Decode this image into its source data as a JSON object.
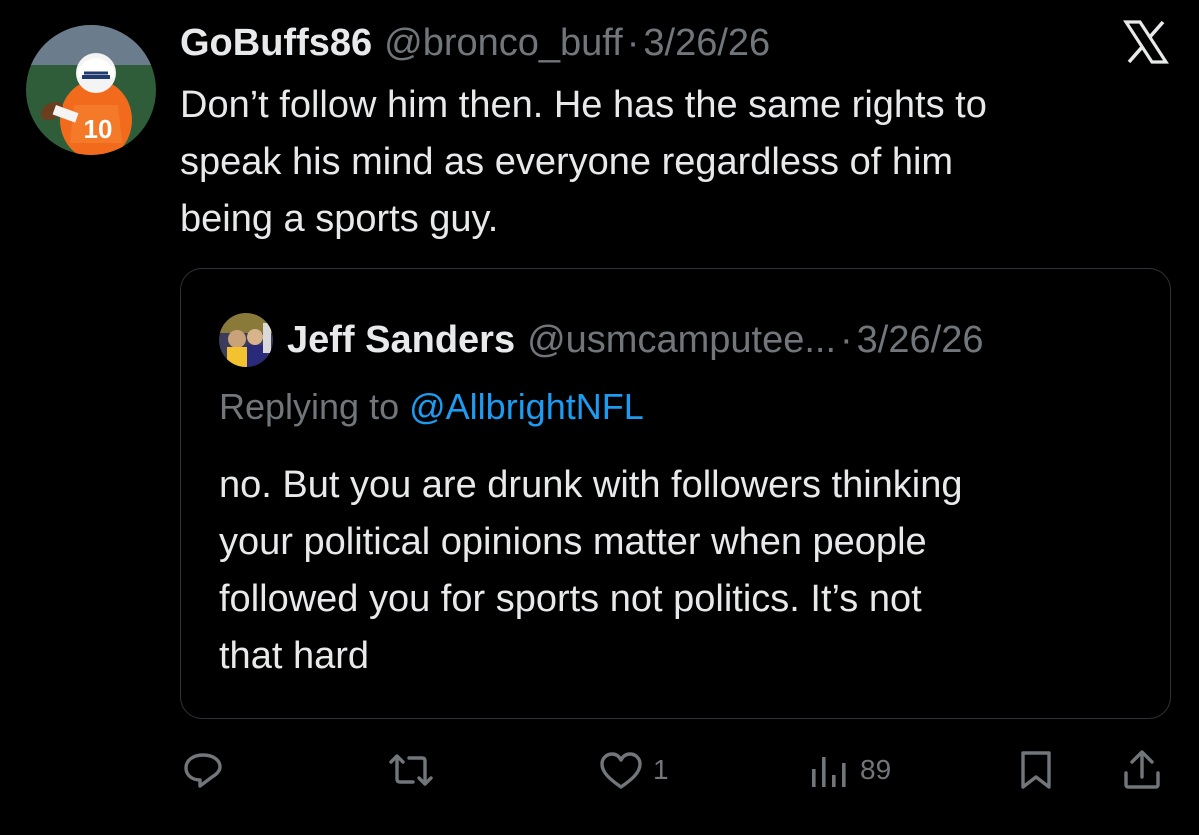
{
  "post": {
    "display_name": "GoBuffs86",
    "handle": "@bronco_buff",
    "separator": "·",
    "date": "3/26/26",
    "avatar_icon": "football-player-avatar",
    "text_lines": [
      "Don’t follow him then. He has the same rights to",
      "speak his mind as everyone regardless of him",
      "being a sports guy."
    ]
  },
  "quoted_post": {
    "display_name": "Jeff Sanders",
    "handle": "@usmcamputee...",
    "separator": "·",
    "date": "3/26/26",
    "avatar_icon": "user-avatar",
    "replying_prefix": "Replying to",
    "replying_to": "@AllbrightNFL",
    "text_lines": [
      "no. But you are drunk with followers thinking",
      "your political opinions matter when people",
      "followed you for sports not politics. It’s not",
      "that hard"
    ]
  },
  "actions": {
    "reply_icon": "reply-icon",
    "repost_icon": "repost-icon",
    "like_icon": "heart-icon",
    "like_count": "1",
    "views_icon": "views-bar-chart-icon",
    "views_count": "89",
    "bookmark_icon": "bookmark-icon",
    "share_icon": "share-icon"
  },
  "colors": {
    "background": "#000000",
    "primary_text": "#e7e9ea",
    "secondary_text": "#71767b",
    "link": "#1d9bf0",
    "border": "#2f3336"
  }
}
